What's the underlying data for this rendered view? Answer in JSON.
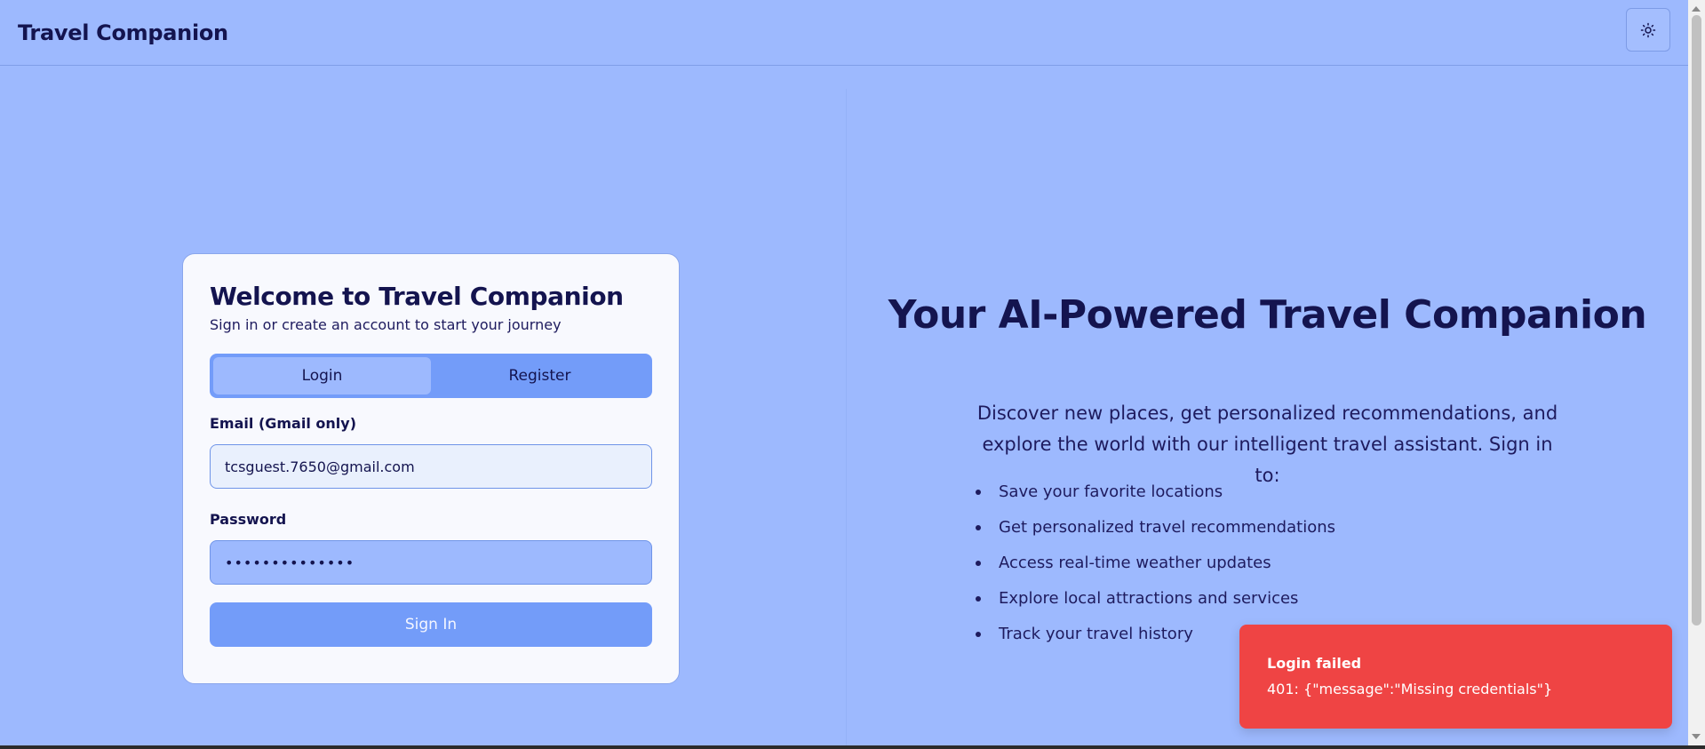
{
  "header": {
    "brand": "Travel Companion",
    "theme_toggle_icon": "sun-icon"
  },
  "auth_card": {
    "title": "Welcome to Travel Companion",
    "subtitle": "Sign in or create an account to start your journey",
    "tabs": [
      {
        "label": "Login",
        "active": true
      },
      {
        "label": "Register",
        "active": false
      }
    ],
    "email": {
      "label": "Email (Gmail only)",
      "value": "tcsguest.7650@gmail.com"
    },
    "password": {
      "label": "Password",
      "value": "••••••••••••••"
    },
    "submit_label": "Sign In"
  },
  "hero": {
    "title": "Your AI-Powered Travel Companion",
    "description": "Discover new places, get personalized recommendations, and explore the world with our intelligent travel assistant. Sign in to:",
    "features": [
      "Save your favorite locations",
      "Get personalized travel recommendations",
      "Access real-time weather updates",
      "Explore local attractions and services",
      "Track your travel history"
    ]
  },
  "toast": {
    "title": "Login failed",
    "message": "401: {\"message\":\"Missing credentials\"}",
    "color": "#ef4444"
  },
  "colors": {
    "background": "#9db9fe",
    "accent": "#739cf9",
    "text": "#14144f",
    "card": "#f8f9fe",
    "error": "#ef4444"
  }
}
